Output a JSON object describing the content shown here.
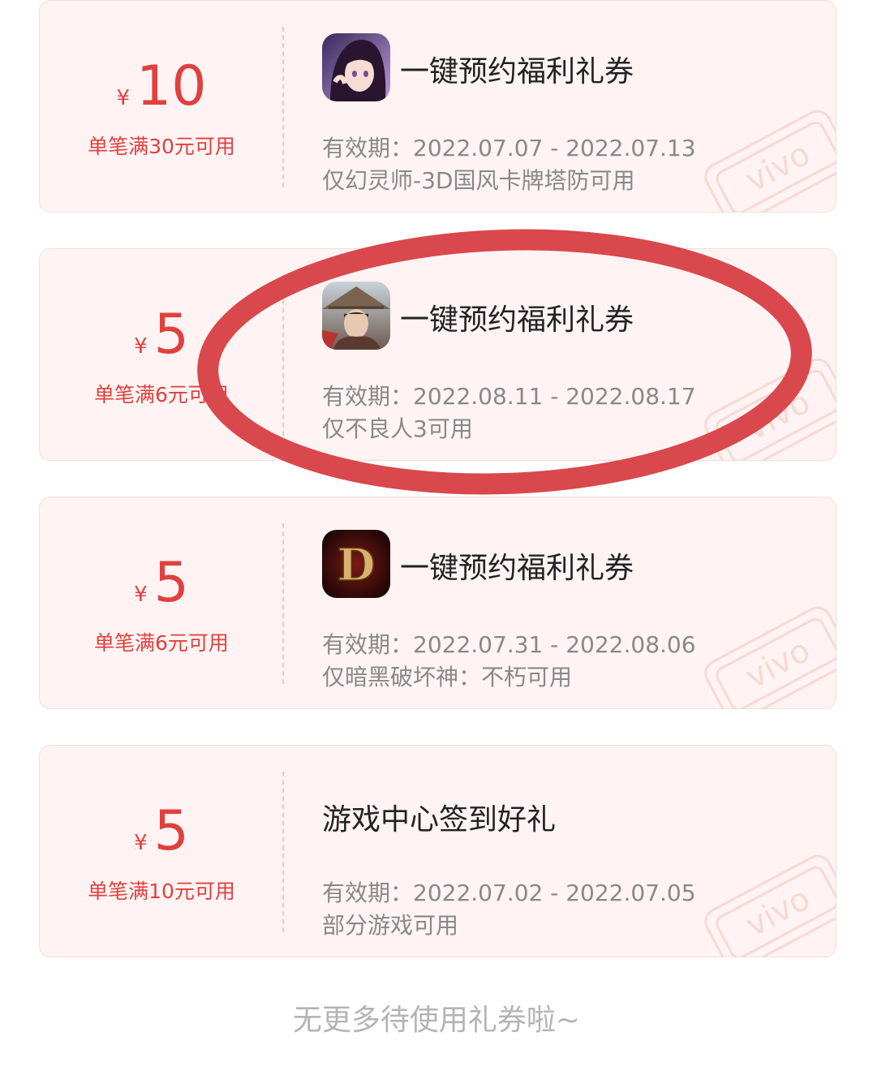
{
  "coupons": [
    {
      "currency_symbol": "¥",
      "amount": "10",
      "condition": "单笔满30元可用",
      "title": "一键预约福利礼券",
      "validity": "有效期：2022.07.07 - 2022.07.13",
      "restriction": "仅幻灵师-3D国风卡牌塔防可用",
      "icon": "anime-girl-game-icon"
    },
    {
      "currency_symbol": "¥",
      "amount": "5",
      "condition": "单笔满6元可用",
      "title": "一键预约福利礼券",
      "validity": "有效期：2022.08.11 - 2022.08.17",
      "restriction": "仅不良人3可用",
      "icon": "swordsman-hat-game-icon"
    },
    {
      "currency_symbol": "¥",
      "amount": "5",
      "condition": "单笔满6元可用",
      "title": "一键预约福利礼券",
      "validity": "有效期：2022.07.31 - 2022.08.06",
      "restriction": "仅暗黑破坏神：不朽可用",
      "icon": "diablo-d-game-icon",
      "icon_letter": "D"
    },
    {
      "currency_symbol": "¥",
      "amount": "5",
      "condition": "单笔满10元可用",
      "title": "游戏中心签到好礼",
      "validity": "有效期：2022.07.02 - 2022.07.05",
      "restriction": "部分游戏可用"
    }
  ],
  "watermark_text": "vivo",
  "footer": "无更多待使用礼券啦~",
  "colors": {
    "accent_red": "#e0403e",
    "card_bg": "#fff4f3",
    "highlight_circle": "#d9484c"
  }
}
